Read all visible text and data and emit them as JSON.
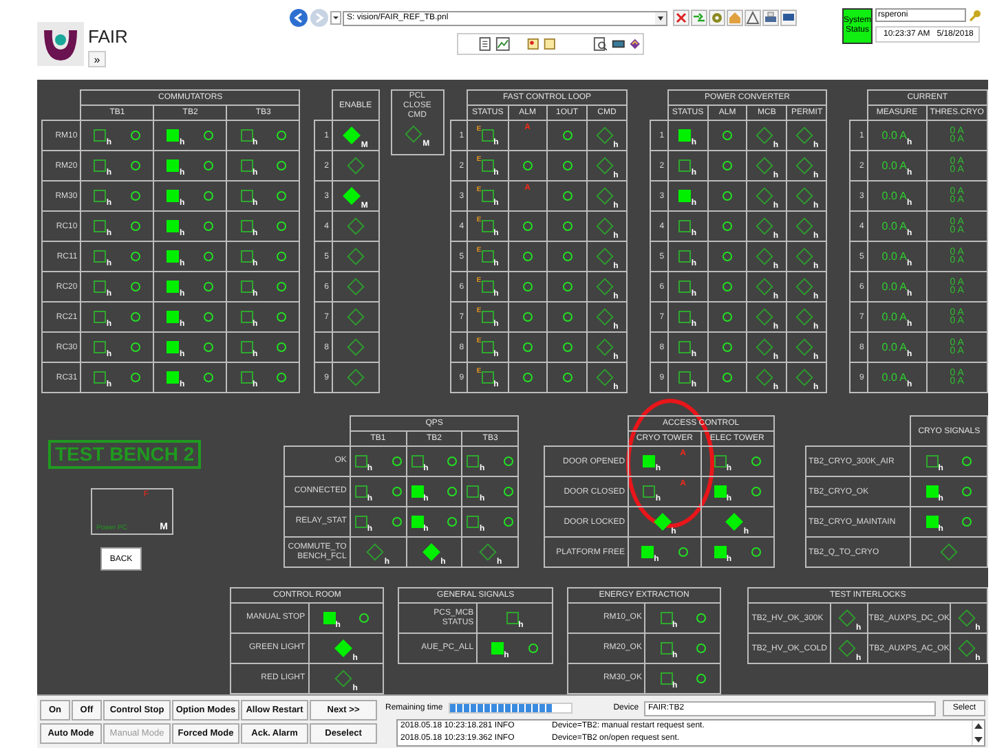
{
  "header": {
    "title": "FAIR",
    "expand_button": "»",
    "path": "S: vision/FAIR_REF_TB.pnl",
    "system_status": "System Status",
    "user": "rsperoni",
    "time": "10:23:37 AM",
    "date": "5/18/2018"
  },
  "commutators": {
    "title": "COMMUTATORS",
    "columns": [
      "TB1",
      "TB2",
      "TB3"
    ],
    "rows": [
      {
        "label": "RM10",
        "cells": [
          [
            {
              "kind": "square",
              "on": false,
              "tag": "h"
            },
            {
              "kind": "circle"
            }
          ],
          [
            {
              "kind": "square",
              "on": true,
              "tag": "h"
            },
            {
              "kind": "circle"
            }
          ],
          [
            {
              "kind": "square",
              "on": false,
              "tag": "h"
            },
            {
              "kind": "circle"
            }
          ]
        ]
      },
      {
        "label": "RM20",
        "cells": [
          [
            {
              "kind": "square",
              "on": false,
              "tag": "h"
            },
            {
              "kind": "circle"
            }
          ],
          [
            {
              "kind": "square",
              "on": true,
              "tag": "h"
            },
            {
              "kind": "circle"
            }
          ],
          [
            {
              "kind": "square",
              "on": false,
              "tag": "h"
            },
            {
              "kind": "circle"
            }
          ]
        ]
      },
      {
        "label": "RM30",
        "cells": [
          [
            {
              "kind": "square",
              "on": false,
              "tag": "h"
            },
            {
              "kind": "circle"
            }
          ],
          [
            {
              "kind": "square",
              "on": true,
              "tag": "h"
            },
            {
              "kind": "circle"
            }
          ],
          [
            {
              "kind": "square",
              "on": false,
              "tag": "h"
            },
            {
              "kind": "circle"
            }
          ]
        ]
      },
      {
        "label": "RC10",
        "cells": [
          [
            {
              "kind": "square",
              "on": false,
              "tag": "h"
            },
            {
              "kind": "circle"
            }
          ],
          [
            {
              "kind": "square",
              "on": true,
              "tag": "h"
            },
            {
              "kind": "circle"
            }
          ],
          [
            {
              "kind": "square",
              "on": false,
              "tag": "h"
            },
            {
              "kind": "circle"
            }
          ]
        ]
      },
      {
        "label": "RC11",
        "cells": [
          [
            {
              "kind": "square",
              "on": false,
              "tag": "h"
            },
            {
              "kind": "circle"
            }
          ],
          [
            {
              "kind": "square",
              "on": true,
              "tag": "h"
            },
            {
              "kind": "circle"
            }
          ],
          [
            {
              "kind": "square",
              "on": false,
              "tag": "h"
            },
            {
              "kind": "circle"
            }
          ]
        ]
      },
      {
        "label": "RC20",
        "cells": [
          [
            {
              "kind": "square",
              "on": false,
              "tag": "h"
            },
            {
              "kind": "circle"
            }
          ],
          [
            {
              "kind": "square",
              "on": true,
              "tag": "h"
            },
            {
              "kind": "circle"
            }
          ],
          [
            {
              "kind": "square",
              "on": false,
              "tag": "h"
            },
            {
              "kind": "circle"
            }
          ]
        ]
      },
      {
        "label": "RC21",
        "cells": [
          [
            {
              "kind": "square",
              "on": false,
              "tag": "h"
            },
            {
              "kind": "circle"
            }
          ],
          [
            {
              "kind": "square",
              "on": true,
              "tag": "h"
            },
            {
              "kind": "circle"
            }
          ],
          [
            {
              "kind": "square",
              "on": false,
              "tag": "h"
            },
            {
              "kind": "circle"
            }
          ]
        ]
      },
      {
        "label": "RC30",
        "cells": [
          [
            {
              "kind": "square",
              "on": false,
              "tag": "h"
            },
            {
              "kind": "circle"
            }
          ],
          [
            {
              "kind": "square",
              "on": true,
              "tag": "h"
            },
            {
              "kind": "circle"
            }
          ],
          [
            {
              "kind": "square",
              "on": false,
              "tag": "h"
            },
            {
              "kind": "circle"
            }
          ]
        ]
      },
      {
        "label": "RC31",
        "cells": [
          [
            {
              "kind": "square",
              "on": false,
              "tag": "h"
            },
            {
              "kind": "circle"
            }
          ],
          [
            {
              "kind": "square",
              "on": true,
              "tag": "h"
            },
            {
              "kind": "circle"
            }
          ],
          [
            {
              "kind": "square",
              "on": false,
              "tag": "h"
            },
            {
              "kind": "circle"
            }
          ]
        ]
      }
    ]
  },
  "enable": {
    "columns": [
      "ENABLE"
    ],
    "rows": [
      {
        "label": "1",
        "cells": [
          [
            {
              "kind": "diamond",
              "on": true,
              "tag": "M"
            }
          ]
        ]
      },
      {
        "label": "2",
        "cells": [
          [
            {
              "kind": "diamond",
              "on": false
            }
          ]
        ]
      },
      {
        "label": "3",
        "cells": [
          [
            {
              "kind": "diamond",
              "on": true,
              "tag": "M"
            }
          ]
        ]
      },
      {
        "label": "4",
        "cells": [
          [
            {
              "kind": "diamond",
              "on": false
            }
          ]
        ]
      },
      {
        "label": "5",
        "cells": [
          [
            {
              "kind": "diamond",
              "on": false
            }
          ]
        ]
      },
      {
        "label": "6",
        "cells": [
          [
            {
              "kind": "diamond",
              "on": false
            }
          ]
        ]
      },
      {
        "label": "7",
        "cells": [
          [
            {
              "kind": "diamond",
              "on": false
            }
          ]
        ]
      },
      {
        "label": "8",
        "cells": [
          [
            {
              "kind": "diamond",
              "on": false
            }
          ]
        ]
      },
      {
        "label": "9",
        "cells": [
          [
            {
              "kind": "diamond",
              "on": false
            }
          ]
        ]
      }
    ]
  },
  "pcl_close_cmd": {
    "title": "PCL CLOSE CMD",
    "indicator": {
      "kind": "diamond",
      "on": false,
      "tag": "M"
    }
  },
  "fast_control_loop": {
    "title": "FAST CONTROL LOOP",
    "columns": [
      "STATUS",
      "ALM",
      "1OUT",
      "CMD"
    ],
    "rows": [
      {
        "label": "1",
        "cells": [
          [
            {
              "kind": "square",
              "on": false,
              "tag": "h",
              "prefix": "E"
            }
          ],
          [
            {
              "kind": "alarm",
              "text": "A"
            }
          ],
          [
            {
              "kind": "circle"
            }
          ],
          [
            {
              "kind": "diamond",
              "on": false,
              "tag": "h"
            }
          ]
        ]
      },
      {
        "label": "2",
        "cells": [
          [
            {
              "kind": "square",
              "on": false,
              "tag": "h",
              "prefix": "E"
            }
          ],
          [
            {
              "kind": "circle"
            }
          ],
          [
            {
              "kind": "circle"
            }
          ],
          [
            {
              "kind": "diamond",
              "on": false,
              "tag": "h"
            }
          ]
        ]
      },
      {
        "label": "3",
        "cells": [
          [
            {
              "kind": "square",
              "on": false,
              "tag": "h",
              "prefix": "E"
            }
          ],
          [
            {
              "kind": "alarm",
              "text": "A"
            }
          ],
          [
            {
              "kind": "circle"
            }
          ],
          [
            {
              "kind": "diamond",
              "on": false,
              "tag": "h"
            }
          ]
        ]
      },
      {
        "label": "4",
        "cells": [
          [
            {
              "kind": "square",
              "on": false,
              "tag": "h",
              "prefix": "E"
            }
          ],
          [
            {
              "kind": "circle"
            }
          ],
          [
            {
              "kind": "circle"
            }
          ],
          [
            {
              "kind": "diamond",
              "on": false,
              "tag": "h"
            }
          ]
        ]
      },
      {
        "label": "5",
        "cells": [
          [
            {
              "kind": "square",
              "on": false,
              "tag": "h",
              "prefix": "E"
            }
          ],
          [
            {
              "kind": "circle"
            }
          ],
          [
            {
              "kind": "circle"
            }
          ],
          [
            {
              "kind": "diamond",
              "on": false,
              "tag": "h"
            }
          ]
        ]
      },
      {
        "label": "6",
        "cells": [
          [
            {
              "kind": "square",
              "on": false,
              "tag": "h",
              "prefix": "E"
            }
          ],
          [
            {
              "kind": "circle"
            }
          ],
          [
            {
              "kind": "circle"
            }
          ],
          [
            {
              "kind": "diamond",
              "on": false,
              "tag": "h"
            }
          ]
        ]
      },
      {
        "label": "7",
        "cells": [
          [
            {
              "kind": "square",
              "on": false,
              "tag": "h",
              "prefix": "E"
            }
          ],
          [
            {
              "kind": "circle"
            }
          ],
          [
            {
              "kind": "circle"
            }
          ],
          [
            {
              "kind": "diamond",
              "on": false,
              "tag": "h"
            }
          ]
        ]
      },
      {
        "label": "8",
        "cells": [
          [
            {
              "kind": "square",
              "on": false,
              "tag": "h",
              "prefix": "E"
            }
          ],
          [
            {
              "kind": "circle"
            }
          ],
          [
            {
              "kind": "circle"
            }
          ],
          [
            {
              "kind": "diamond",
              "on": false,
              "tag": "h"
            }
          ]
        ]
      },
      {
        "label": "9",
        "cells": [
          [
            {
              "kind": "square",
              "on": false,
              "tag": "h",
              "prefix": "E"
            }
          ],
          [
            {
              "kind": "circle"
            }
          ],
          [
            {
              "kind": "circle"
            }
          ],
          [
            {
              "kind": "diamond",
              "on": false,
              "tag": "h"
            }
          ]
        ]
      }
    ]
  },
  "power_converter": {
    "title": "POWER CONVERTER",
    "columns": [
      "STATUS",
      "ALM",
      "MCB",
      "PERMIT"
    ],
    "rows": [
      {
        "label": "1",
        "cells": [
          [
            {
              "kind": "square",
              "on": true,
              "tag": "h"
            }
          ],
          [
            {
              "kind": "circle"
            }
          ],
          [
            {
              "kind": "diamond",
              "on": false,
              "tag": "h"
            }
          ],
          [
            {
              "kind": "diamond",
              "on": false,
              "tag": "h"
            }
          ]
        ]
      },
      {
        "label": "2",
        "cells": [
          [
            {
              "kind": "square",
              "on": false,
              "tag": "h"
            }
          ],
          [
            {
              "kind": "circle"
            }
          ],
          [
            {
              "kind": "diamond",
              "on": false,
              "tag": "h"
            }
          ],
          [
            {
              "kind": "diamond",
              "on": false,
              "tag": "h"
            }
          ]
        ]
      },
      {
        "label": "3",
        "cells": [
          [
            {
              "kind": "square",
              "on": true,
              "tag": "h"
            }
          ],
          [
            {
              "kind": "circle"
            }
          ],
          [
            {
              "kind": "diamond",
              "on": false,
              "tag": "h"
            }
          ],
          [
            {
              "kind": "diamond",
              "on": false,
              "tag": "h"
            }
          ]
        ]
      },
      {
        "label": "4",
        "cells": [
          [
            {
              "kind": "square",
              "on": false,
              "tag": "h"
            }
          ],
          [
            {
              "kind": "circle"
            }
          ],
          [
            {
              "kind": "diamond",
              "on": false,
              "tag": "h"
            }
          ],
          [
            {
              "kind": "diamond",
              "on": false,
              "tag": "h"
            }
          ]
        ]
      },
      {
        "label": "5",
        "cells": [
          [
            {
              "kind": "square",
              "on": false,
              "tag": "h"
            }
          ],
          [
            {
              "kind": "circle"
            }
          ],
          [
            {
              "kind": "diamond",
              "on": false,
              "tag": "h"
            }
          ],
          [
            {
              "kind": "diamond",
              "on": false,
              "tag": "h"
            }
          ]
        ]
      },
      {
        "label": "6",
        "cells": [
          [
            {
              "kind": "square",
              "on": false,
              "tag": "h"
            }
          ],
          [
            {
              "kind": "circle"
            }
          ],
          [
            {
              "kind": "diamond",
              "on": false,
              "tag": "h"
            }
          ],
          [
            {
              "kind": "diamond",
              "on": false,
              "tag": "h"
            }
          ]
        ]
      },
      {
        "label": "7",
        "cells": [
          [
            {
              "kind": "square",
              "on": false,
              "tag": "h"
            }
          ],
          [
            {
              "kind": "circle"
            }
          ],
          [
            {
              "kind": "diamond",
              "on": false,
              "tag": "h"
            }
          ],
          [
            {
              "kind": "diamond",
              "on": false,
              "tag": "h"
            }
          ]
        ]
      },
      {
        "label": "8",
        "cells": [
          [
            {
              "kind": "square",
              "on": false,
              "tag": "h"
            }
          ],
          [
            {
              "kind": "circle"
            }
          ],
          [
            {
              "kind": "diamond",
              "on": false,
              "tag": "h"
            }
          ],
          [
            {
              "kind": "diamond",
              "on": false,
              "tag": "h"
            }
          ]
        ]
      },
      {
        "label": "9",
        "cells": [
          [
            {
              "kind": "square",
              "on": false,
              "tag": "h"
            }
          ],
          [
            {
              "kind": "circle"
            }
          ],
          [
            {
              "kind": "diamond",
              "on": false,
              "tag": "h"
            }
          ],
          [
            {
              "kind": "diamond",
              "on": false,
              "tag": "h"
            }
          ]
        ]
      }
    ]
  },
  "current": {
    "title": "CURRENT",
    "columns": [
      "MEASURE",
      "THRES.CRYO"
    ],
    "rows": [
      {
        "label": "1",
        "cells": [
          [
            {
              "kind": "reading",
              "text": "0.0 A",
              "tag": "h"
            }
          ],
          [
            {
              "kind": "double_reading",
              "lines": [
                "0 A",
                "0 A"
              ]
            }
          ]
        ]
      },
      {
        "label": "2",
        "cells": [
          [
            {
              "kind": "reading",
              "text": "0.0 A",
              "tag": "h"
            }
          ],
          [
            {
              "kind": "double_reading",
              "lines": [
                "0 A",
                "0 A"
              ]
            }
          ]
        ]
      },
      {
        "label": "3",
        "cells": [
          [
            {
              "kind": "reading",
              "text": "0.0 A",
              "tag": "h"
            }
          ],
          [
            {
              "kind": "double_reading",
              "lines": [
                "0 A",
                "0 A"
              ]
            }
          ]
        ]
      },
      {
        "label": "4",
        "cells": [
          [
            {
              "kind": "reading",
              "text": "0.0 A",
              "tag": "h"
            }
          ],
          [
            {
              "kind": "double_reading",
              "lines": [
                "0 A",
                "0 A"
              ]
            }
          ]
        ]
      },
      {
        "label": "5",
        "cells": [
          [
            {
              "kind": "reading",
              "text": "0.0 A",
              "tag": "h"
            }
          ],
          [
            {
              "kind": "double_reading",
              "lines": [
                "0 A",
                "0 A"
              ]
            }
          ]
        ]
      },
      {
        "label": "6",
        "cells": [
          [
            {
              "kind": "reading",
              "text": "0.0 A",
              "tag": "h"
            }
          ],
          [
            {
              "kind": "double_reading",
              "lines": [
                "0 A",
                "0 A"
              ]
            }
          ]
        ]
      },
      {
        "label": "7",
        "cells": [
          [
            {
              "kind": "reading",
              "text": "0.0 A",
              "tag": "h"
            }
          ],
          [
            {
              "kind": "double_reading",
              "lines": [
                "0 A",
                "0 A"
              ]
            }
          ]
        ]
      },
      {
        "label": "8",
        "cells": [
          [
            {
              "kind": "reading",
              "text": "0.0 A",
              "tag": "h"
            }
          ],
          [
            {
              "kind": "double_reading",
              "lines": [
                "0 A",
                "0 A"
              ]
            }
          ]
        ]
      },
      {
        "label": "9",
        "cells": [
          [
            {
              "kind": "reading",
              "text": "0.0 A",
              "tag": "h"
            }
          ],
          [
            {
              "kind": "double_reading",
              "lines": [
                "0 A",
                "0 A"
              ]
            }
          ]
        ]
      }
    ]
  },
  "test_bench": {
    "title": "TEST BENCH 2",
    "power_pc": {
      "fault": "F",
      "label": "Power PC",
      "mode": "M"
    },
    "back_button": "BACK"
  },
  "qps": {
    "title": "QPS",
    "columns": [
      "TB1",
      "TB2",
      "TB3"
    ],
    "rows": [
      {
        "label": "OK",
        "cells": [
          [
            {
              "kind": "square",
              "on": false,
              "tag": "h"
            },
            {
              "kind": "circle"
            }
          ],
          [
            {
              "kind": "square",
              "on": false,
              "tag": "h"
            },
            {
              "kind": "circle"
            }
          ],
          [
            {
              "kind": "square",
              "on": false,
              "tag": "h"
            },
            {
              "kind": "circle"
            }
          ]
        ]
      },
      {
        "label": "CONNECTED",
        "cells": [
          [
            {
              "kind": "square",
              "on": false,
              "tag": "h"
            },
            {
              "kind": "circle"
            }
          ],
          [
            {
              "kind": "square",
              "on": true,
              "tag": "h"
            },
            {
              "kind": "circle"
            }
          ],
          [
            {
              "kind": "square",
              "on": false,
              "tag": "h"
            },
            {
              "kind": "circle"
            }
          ]
        ]
      },
      {
        "label": "RELAY_STAT",
        "cells": [
          [
            {
              "kind": "square",
              "on": false,
              "tag": "h"
            },
            {
              "kind": "circle"
            }
          ],
          [
            {
              "kind": "square",
              "on": true,
              "tag": "h"
            },
            {
              "kind": "circle"
            }
          ],
          [
            {
              "kind": "square",
              "on": false,
              "tag": "h"
            },
            {
              "kind": "circle"
            }
          ]
        ]
      },
      {
        "label": "COMMUTE_TO BENCH_FCL",
        "cells": [
          [
            {
              "kind": "diamond",
              "on": false,
              "tag": "h"
            }
          ],
          [
            {
              "kind": "diamond",
              "on": true,
              "tag": "h"
            }
          ],
          [
            {
              "kind": "diamond",
              "on": false,
              "tag": "h"
            }
          ]
        ]
      }
    ]
  },
  "access_control": {
    "title": "ACCESS CONTROL",
    "columns": [
      "CRYO TOWER",
      "ELEC TOWER"
    ],
    "rows": [
      {
        "label": "DOOR OPENED",
        "cells": [
          [
            {
              "kind": "square",
              "on": true,
              "tag": "h"
            },
            {
              "kind": "alarm",
              "text": "A"
            }
          ],
          [
            {
              "kind": "square",
              "on": false,
              "tag": "h"
            },
            {
              "kind": "circle"
            }
          ]
        ]
      },
      {
        "label": "DOOR CLOSED",
        "cells": [
          [
            {
              "kind": "square",
              "on": false,
              "tag": "h"
            },
            {
              "kind": "alarm",
              "text": "A"
            }
          ],
          [
            {
              "kind": "square",
              "on": true,
              "tag": "h"
            },
            {
              "kind": "circle"
            }
          ]
        ]
      },
      {
        "label": "DOOR LOCKED",
        "cells": [
          [
            {
              "kind": "diamond",
              "on": true,
              "tag": "h"
            }
          ],
          [
            {
              "kind": "diamond",
              "on": true,
              "tag": "h"
            }
          ]
        ]
      },
      {
        "label": "PLATFORM FREE",
        "cells": [
          [
            {
              "kind": "square",
              "on": true,
              "tag": "h"
            },
            {
              "kind": "circle"
            }
          ],
          [
            {
              "kind": "square",
              "on": true,
              "tag": "h"
            },
            {
              "kind": "circle"
            }
          ]
        ]
      }
    ]
  },
  "cryo_signals": {
    "columns": [
      "CRYO SIGNALS"
    ],
    "rows": [
      {
        "label": "TB2_CRYO_300K_AIR",
        "cells": [
          [
            {
              "kind": "square",
              "on": false,
              "tag": "h"
            },
            {
              "kind": "circle"
            }
          ]
        ]
      },
      {
        "label": "TB2_CRYO_OK",
        "cells": [
          [
            {
              "kind": "square",
              "on": true,
              "tag": "h"
            },
            {
              "kind": "circle"
            }
          ]
        ]
      },
      {
        "label": "TB2_CRYO_MAINTAIN",
        "cells": [
          [
            {
              "kind": "square",
              "on": true,
              "tag": "h"
            },
            {
              "kind": "circle"
            }
          ]
        ]
      },
      {
        "label": "TB2_Q_TO_CRYO",
        "cells": [
          [
            {
              "kind": "diamond",
              "on": false
            }
          ]
        ]
      }
    ]
  },
  "control_room": {
    "title": "CONTROL ROOM",
    "rows": [
      {
        "label": "MANUAL STOP",
        "cells": [
          [
            {
              "kind": "square",
              "on": true,
              "tag": "h"
            },
            {
              "kind": "circle"
            }
          ]
        ]
      },
      {
        "label": "GREEN LIGHT",
        "cells": [
          [
            {
              "kind": "diamond",
              "on": true,
              "tag": "h"
            }
          ]
        ]
      },
      {
        "label": "RED LIGHT",
        "cells": [
          [
            {
              "kind": "diamond",
              "on": false,
              "tag": "h"
            }
          ]
        ]
      }
    ]
  },
  "general_signals": {
    "title": "GENERAL SIGNALS",
    "rows": [
      {
        "label": "PCS_MCB STATUS",
        "cells": [
          [
            {
              "kind": "square",
              "on": false,
              "tag": "h"
            }
          ]
        ]
      },
      {
        "label": "AUE_PC_ALL",
        "cells": [
          [
            {
              "kind": "square",
              "on": true,
              "tag": "h"
            },
            {
              "kind": "circle"
            }
          ]
        ]
      }
    ]
  },
  "energy_extraction": {
    "title": "ENERGY EXTRACTION",
    "rows": [
      {
        "label": "RM10_OK",
        "cells": [
          [
            {
              "kind": "square",
              "on": false,
              "tag": "h"
            },
            {
              "kind": "circle"
            }
          ]
        ]
      },
      {
        "label": "RM20_OK",
        "cells": [
          [
            {
              "kind": "square",
              "on": false,
              "tag": "h"
            },
            {
              "kind": "circle"
            }
          ]
        ]
      },
      {
        "label": "RM30_OK",
        "cells": [
          [
            {
              "kind": "square",
              "on": false,
              "tag": "h"
            },
            {
              "kind": "circle"
            }
          ]
        ]
      }
    ]
  },
  "test_interlocks": {
    "title": "TEST INTERLOCKS",
    "rows": [
      {
        "label": "TB2_HV_OK_300K",
        "cells": [
          [
            {
              "kind": "diamond",
              "on": false,
              "tag": "h"
            }
          ],
          [
            {
              "kind": "text",
              "text": "TB2_AUXPS_DC_OK"
            }
          ],
          [
            {
              "kind": "diamond",
              "on": false,
              "tag": "h"
            }
          ]
        ]
      },
      {
        "label": "TB2_HV_OK_COLD",
        "cells": [
          [
            {
              "kind": "diamond",
              "on": false,
              "tag": "h"
            }
          ],
          [
            {
              "kind": "text",
              "text": "TB2_AUXPS_AC_OK"
            }
          ],
          [
            {
              "kind": "diamond",
              "on": false,
              "tag": "h"
            }
          ]
        ]
      }
    ]
  },
  "controls": {
    "buttons": [
      {
        "label": "On",
        "disabled": false
      },
      {
        "label": "Off",
        "disabled": false
      },
      {
        "label": "Control Stop",
        "disabled": false
      },
      {
        "label": "Option Modes",
        "disabled": false
      },
      {
        "label": "Allow Restart",
        "disabled": false
      },
      {
        "label": "Next >>",
        "disabled": false
      },
      {
        "label": "Auto Mode",
        "disabled": false
      },
      {
        "label": "Manual Mode",
        "disabled": true
      },
      {
        "label": "Forced Mode",
        "disabled": false
      },
      {
        "label": "Ack. Alarm",
        "disabled": false
      },
      {
        "label": "Deselect",
        "disabled": false
      }
    ]
  },
  "remaining_time": {
    "label": "Remaining time",
    "level": 0.86
  },
  "device": {
    "label": "Device",
    "value": "FAIR:TB2",
    "button": "Select"
  },
  "log": [
    {
      "timestamp": "2018.05.18 10:23:18.281",
      "level": "INFO",
      "message": "Device=TB2: manual restart request sent."
    },
    {
      "timestamp": "2018.05.18 10:23:19.362",
      "level": "INFO",
      "message": "Device=TB2 on/open request sent."
    }
  ]
}
